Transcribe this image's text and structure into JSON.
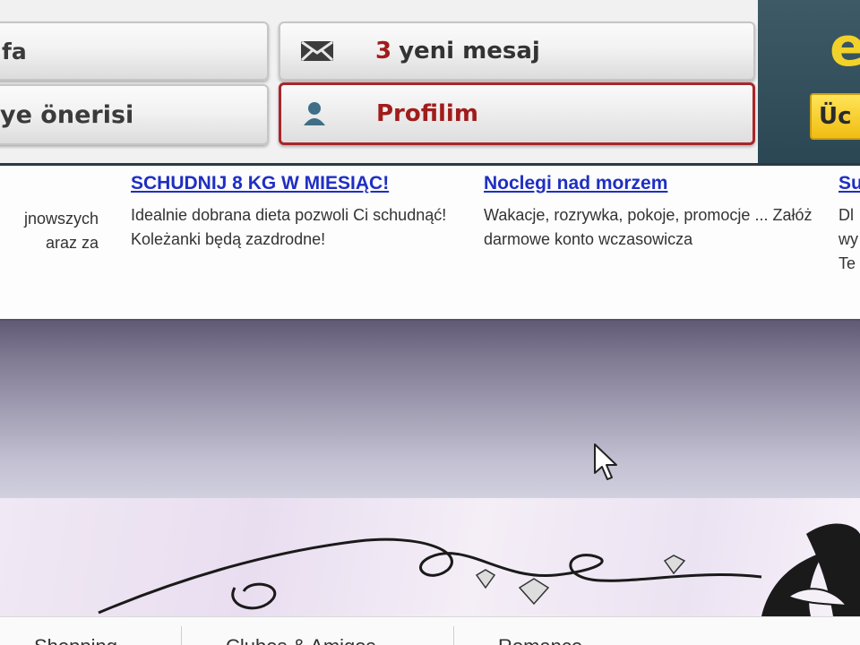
{
  "nav_buttons": {
    "fa": {
      "label": "fa"
    },
    "oneri": {
      "label": "ye önerisi"
    },
    "mesaj": {
      "count": "3",
      "label": "yeni mesaj",
      "icon": "envelope-icon"
    },
    "profil": {
      "label": "Profilim",
      "icon": "user-icon"
    }
  },
  "promo": {
    "letter": "e",
    "button_label": "Üc"
  },
  "ads": [
    {
      "title": "",
      "text": "jnowszych\naraz za"
    },
    {
      "title": "SCHUDNIJ 8 KG W MIESIĄC!",
      "text": "Idealnie dobrana dieta pozwoli Ci schudnąć! Koleżanki będą zazdrodne!"
    },
    {
      "title": "Noclegi nad morzem",
      "text": "Wakacje, rozrywka, pokoje, promocje ... Załóż darmowe konto wczasowicza"
    },
    {
      "title": "Su",
      "text": "Dl\nwy\nTe"
    }
  ],
  "bottom_nav": [
    {
      "label": "Shopping"
    },
    {
      "label": "Clubes & Amigos"
    },
    {
      "label": "Romance"
    }
  ],
  "colors": {
    "accent_red": "#a11c1c",
    "link_blue": "#1f2fc2",
    "promo_yellow": "#f2d22a",
    "promo_bg": "#2f4b57"
  }
}
